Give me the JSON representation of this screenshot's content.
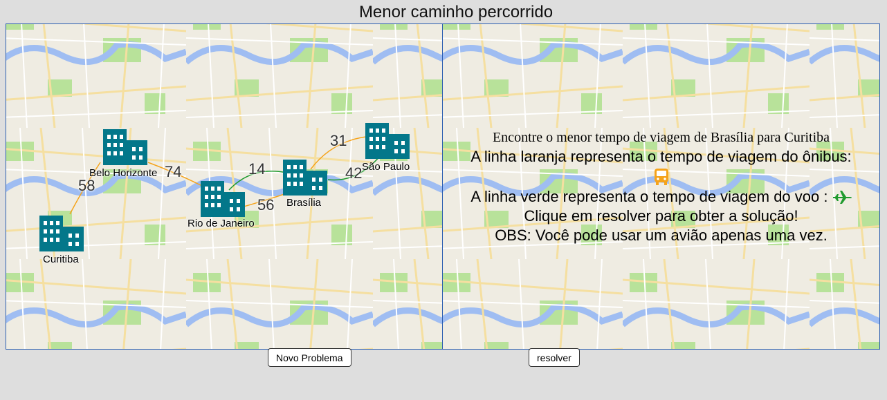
{
  "page": {
    "title": "Menor caminho percorrido"
  },
  "graph": {
    "cities": [
      {
        "id": "bh",
        "name": "Belo Horizonte"
      },
      {
        "id": "rj",
        "name": "Rio de Janeiro"
      },
      {
        "id": "bsb",
        "name": "Brasília"
      },
      {
        "id": "sp",
        "name": "São Paulo"
      },
      {
        "id": "cwb",
        "name": "Curitiba"
      }
    ],
    "edges": [
      {
        "from": "cwb",
        "to": "bh",
        "weight": "58",
        "mode": "bus"
      },
      {
        "from": "bh",
        "to": "rj",
        "weight": "74",
        "mode": "bus"
      },
      {
        "from": "rj",
        "to": "bsb",
        "weight": "14",
        "mode": "flight"
      },
      {
        "from": "rj",
        "to": "bsb",
        "weight": "56",
        "mode": "bus"
      },
      {
        "from": "bsb",
        "to": "sp",
        "weight": "31",
        "mode": "bus"
      },
      {
        "from": "bsb",
        "to": "sp",
        "weight": "42",
        "mode": "flight"
      }
    ],
    "colors": {
      "bus": "#f5a31a",
      "flight": "#1f9a2e",
      "city": "#03778a"
    }
  },
  "info": {
    "heading": "Encontre o menor tempo de viagem de Brasília para Curitiba",
    "bus_line": "A linha laranja representa o tempo de viagem do ônibus:",
    "flight_line": "A linha verde representa o tempo de viagem do voo :",
    "click_line": "Clique em resolver para obter a solução!",
    "obs_line": "OBS: Você pode usar um avião apenas uma vez.",
    "bus_icon": "bus-icon",
    "plane_icon": "airplane-icon"
  },
  "buttons": {
    "new_problem": "Novo Problema",
    "resolve": "resolver"
  }
}
